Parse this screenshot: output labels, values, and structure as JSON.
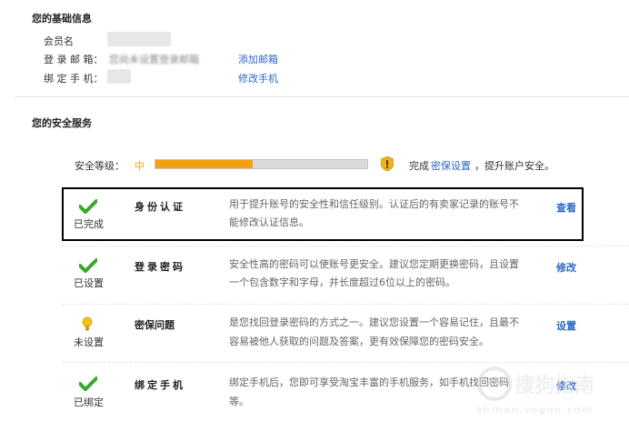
{
  "basic_info": {
    "title": "您的基础信息",
    "member_label": "会员名",
    "email_label": "登 录 邮 箱：",
    "email_value": "您尚未设置登录邮箱",
    "add_email_link": "添加邮箱",
    "phone_label": "绑 定 手 机：",
    "edit_phone_link": "修改手机"
  },
  "security": {
    "title": "您的安全服务",
    "level_label": "安全等级：",
    "level_value": "中",
    "level_progress": 0.46,
    "level_color": "#f5a011",
    "hint_prefix": "完成",
    "hint_link": "密保设置",
    "hint_suffix": "，提升账户安全。",
    "rows": [
      {
        "title": "身份认证",
        "status": "已完成",
        "icon": "check-icon",
        "desc_line1": "用于提升账号的安全性和信任级别。认证后的有卖家记录的账号不",
        "desc_line2": "能修改认证信息。",
        "action": "查看"
      },
      {
        "title": "登录密码",
        "status": "已设置",
        "icon": "check-icon",
        "desc_line1": "安全性高的密码可以使账号更安全。建议您定期更换密码，且设置",
        "desc_line2": "一个包含数字和字母，并长度超过6位以上的密码。",
        "action": "修改"
      },
      {
        "title": "密保问题",
        "status": "未设置",
        "icon": "lightbulb-icon",
        "desc_line1": "是您找回登录密码的方式之一。建议您设置一个容易记住，且最不",
        "desc_line2": "容易被他人获取的问题及答案，更有效保障您的密码安全。",
        "action": "设置"
      },
      {
        "title": "绑定手机",
        "status": "已绑定",
        "icon": "check-icon",
        "desc_line1": "绑定手机后，您即可享受淘宝丰富的手机服务，如手机找回密码",
        "desc_line2": "等。",
        "action": "修改"
      }
    ]
  },
  "watermark": {
    "line1": "搜狗指南",
    "line2": "zhinan.sogou.com"
  },
  "colors": {
    "link": "#2c68c5",
    "check": "#3aa82a",
    "bulb": "#f2c21a"
  }
}
